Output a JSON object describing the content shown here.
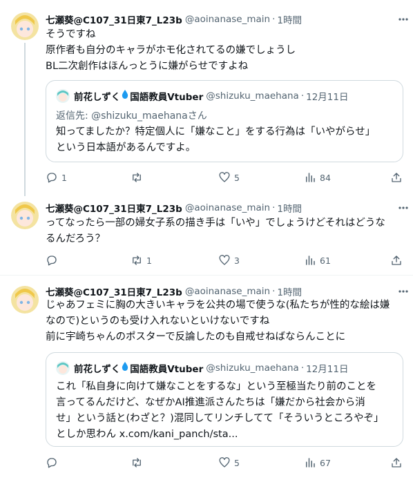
{
  "tweets": [
    {
      "author": {
        "name": "七瀬葵@C107_31日東7_L23b",
        "handle": "@aoinanase_main"
      },
      "time": "1時間",
      "lines": [
        "そうですね",
        "原作者も自分のキャラがホモ化されてるの嫌でしょうし",
        "BL二次創作はほんっとうに嫌がらせですよね"
      ],
      "quote": {
        "name_part1": "前花しずく",
        "name_part2": "国語教員Vtuber",
        "handle": "@shizuku_maehana",
        "date": "12月11日",
        "replying_to": "返信先: @shizuku_maehanaさん",
        "lines": [
          "知ってましたか？特定個人に「嫌なこと」をする行為は「いやがらせ」",
          "という日本語があるんですよ。"
        ]
      },
      "stats": {
        "replies": "1",
        "retweets": "",
        "likes": "5",
        "views": "84"
      }
    },
    {
      "author": {
        "name": "七瀬葵@C107_31日東7_L23b",
        "handle": "@aoinanase_main"
      },
      "time": "1時間",
      "lines": [
        "ってなったら一部の婦女子系の描き手は「いや」でしょうけどそれはどうな",
        "るんだろう？"
      ],
      "stats": {
        "replies": "",
        "retweets": "1",
        "likes": "3",
        "views": "61"
      }
    },
    {
      "author": {
        "name": "七瀬葵@C107_31日東7_L23b",
        "handle": "@aoinanase_main"
      },
      "time": "1時間",
      "lines": [
        "じゃあフェミに胸の大きいキャラを公共の場で使うな(私たちが性的な絵は嫌",
        "なので)というのも受け入れないといけないですね",
        "前に宇崎ちゃんのポスターで反論したのも自戒せねばならんことに"
      ],
      "quote": {
        "name_part1": "前花しずく",
        "name_part2": "国語教員Vtuber",
        "handle": "@shizuku_maehana",
        "date": "12月11日",
        "lines": [
          "これ「私自身に向けて嫌なことをするな」という至極当たり前のことを",
          "言ってるんだけど、なぜかAI推進派さんたちは「嫌だから社会から消",
          "せ」という話と(わざと？)混同してリンチしてて「そういうところやぞ」",
          "としか思わん x.com/kani_panch/sta..."
        ]
      },
      "stats": {
        "replies": "",
        "retweets": "",
        "likes": "5",
        "views": "67"
      }
    }
  ],
  "separator": "·",
  "icons": {
    "more": "more-icon",
    "reply": "reply-icon",
    "retweet": "retweet-icon",
    "like": "like-icon",
    "views": "views-icon",
    "share": "share-icon",
    "droplet": "droplet-icon"
  },
  "colors": {
    "text": "#0f1419",
    "secondary": "#536471",
    "border": "#cfd9de",
    "droplet": "#1d9bf0"
  }
}
